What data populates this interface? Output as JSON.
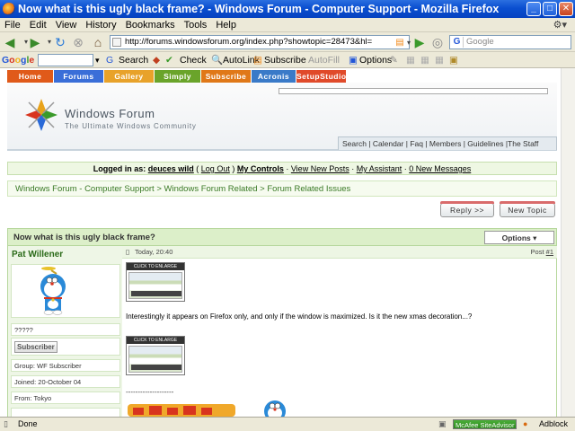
{
  "window": {
    "title": "Now what is this ugly black frame? - Windows Forum - Computer Support - Mozilla Firefox",
    "minimize": "_",
    "maximize": "□",
    "close": "✕"
  },
  "menu": [
    "File",
    "Edit",
    "View",
    "History",
    "Bookmarks",
    "Tools",
    "Help"
  ],
  "nav": {
    "url": "http://forums.windowsforum.org/index.php?showtopic=28473&hl=",
    "search_placeholder": "Google"
  },
  "google_toolbar": {
    "label": "Google",
    "items": [
      "Search",
      "Check",
      "AutoLink",
      "Subscribe",
      "AutoFill",
      "Options"
    ]
  },
  "site": {
    "tabs": [
      {
        "label": "Home",
        "color": "#e05a1a"
      },
      {
        "label": "Forums",
        "color": "#3a6ed8"
      },
      {
        "label": "Gallery",
        "color": "#e8a22a"
      },
      {
        "label": "Simply",
        "color": "#6aa42a"
      },
      {
        "label": "Subscribe",
        "color": "#e07818"
      },
      {
        "label": "Acronis",
        "color": "#3a7ac8"
      },
      {
        "label": "SetupStudio",
        "color": "#e04a2a"
      }
    ],
    "logo_title": "Windows Forum",
    "logo_subtitle": "The Ultimate Windows Community",
    "top_links": [
      "Search",
      "Calendar",
      "Faq",
      "Members",
      "Guidelines",
      "The Staff"
    ]
  },
  "userbar": {
    "logged_in_label": "Logged in as:",
    "username": "deuces wild",
    "logout": "Log Out",
    "my_controls": "My Controls",
    "view_new_posts": "View New Posts",
    "my_assistant": "My Assistant",
    "new_messages": "0 New Messages"
  },
  "breadcrumb": [
    "Windows Forum - Computer Support",
    "Windows Forum Related",
    "Forum Related Issues"
  ],
  "buttons": {
    "reply": "Reply >>",
    "new_topic": "New Topic"
  },
  "topic": {
    "title": "Now what is this ugly black frame?",
    "options": "Options ▾"
  },
  "post": {
    "author": "Pat Willener",
    "stars": "?????",
    "badge": "Subscriber",
    "group": "Group: WF Subscriber",
    "joined": "Joined: 20-October 04",
    "from": "From: Tokyo",
    "date": "Today, 20:40",
    "post_number_label": "Post",
    "post_number": "#1",
    "thumb_caption": "CLICK TO ENLARGE",
    "text": "Interestingly it appears on Firefox only, and only if the window is maximized. Is it the new xmas decoration...?",
    "separator": "--------------------"
  },
  "status": {
    "text": "Done",
    "siteadvisor": "McAfee SiteAdvisor",
    "adblock": "Adblock"
  }
}
